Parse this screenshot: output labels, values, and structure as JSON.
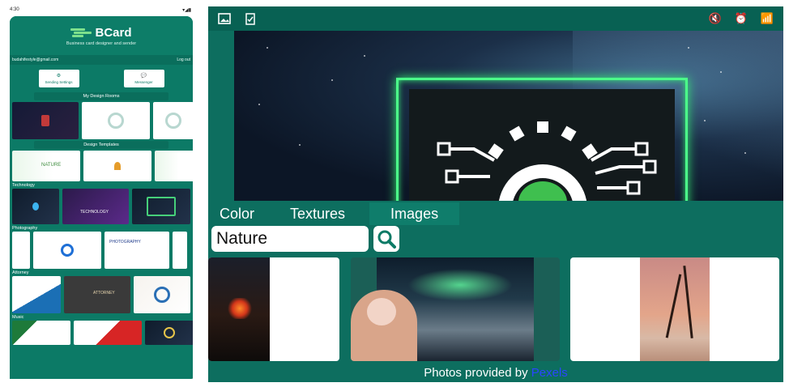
{
  "phone": {
    "status": {
      "time": "4:30",
      "icons": "▾◢▮"
    },
    "app": {
      "title": "BCard",
      "tagline": "Business card designer and sender",
      "account_email": "budahifestyle@gmail.com",
      "logout_label": "Log out",
      "actions": [
        {
          "label": "Sending Settings",
          "icon": "settings-icon"
        },
        {
          "label": "Messenger",
          "icon": "chat-icon"
        }
      ],
      "sections": {
        "design_rooms": "My Design Rooms",
        "templates": "Design Templates"
      },
      "categories": {
        "technology": "Technology",
        "photography": "Photography",
        "attorney": "Attorney",
        "music": "Music"
      },
      "card_texts": {
        "nature": "NATURE",
        "technology": "TECHNOLOGY",
        "photography": "PHOTOGRAPHY",
        "attorney": "ATTORNEY"
      }
    }
  },
  "tablet": {
    "tabs": [
      {
        "label": "Color",
        "active": false
      },
      {
        "label": "Textures",
        "active": false
      },
      {
        "label": "Images",
        "active": true
      }
    ],
    "search": {
      "value": "Nature"
    },
    "credit": {
      "prefix": "Photos provided by",
      "link": "Pexels"
    }
  },
  "colors": {
    "brand": "#0c7a66",
    "neon": "#4cff8a",
    "link": "#2b45ff"
  }
}
